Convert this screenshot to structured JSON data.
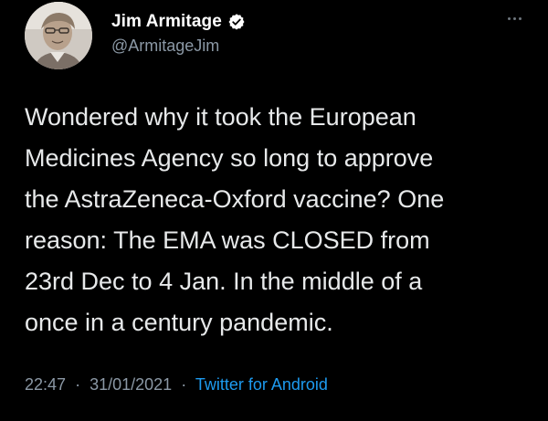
{
  "user": {
    "display_name": "Jim Armitage",
    "handle": "@ArmitageJim",
    "verified": true
  },
  "tweet": {
    "lines": [
      "Wondered why it took the European",
      "Medicines Agency so long to approve",
      "the AstraZeneca-Oxford vaccine? One",
      "reason: The EMA was CLOSED from",
      "23rd Dec to 4 Jan. In the middle of a",
      "once in a century pandemic."
    ]
  },
  "meta": {
    "time": "22:47",
    "separator": "·",
    "date": "31/01/2021",
    "source": "Twitter for Android"
  },
  "icons": {
    "verified": "verified-badge-icon",
    "more": "more-options-icon"
  },
  "colors": {
    "background": "#000000",
    "text": "#e7e9ea",
    "secondary": "#8b98a5",
    "link": "#1d9bf0"
  }
}
